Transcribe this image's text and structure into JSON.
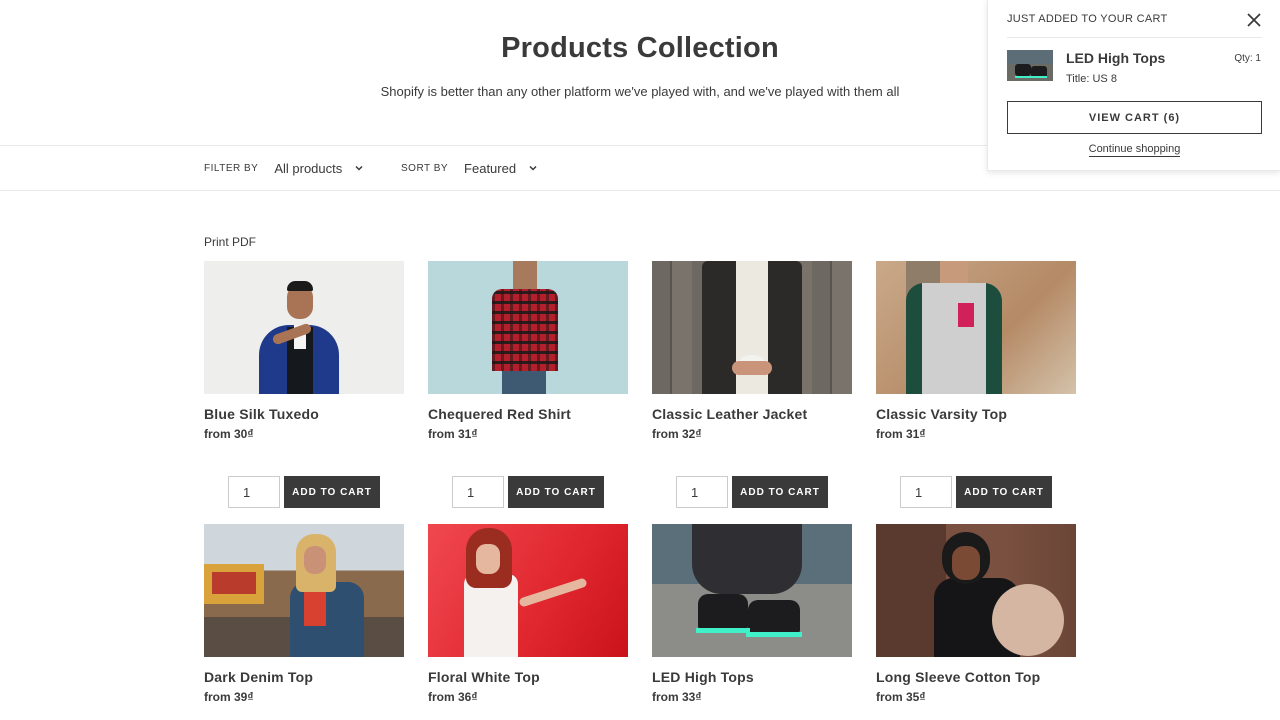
{
  "collection": {
    "title": "Products Collection",
    "description": "Shopify is better than any other platform we've played with, and we've played with them all"
  },
  "filters": {
    "filter_label": "FILTER BY",
    "filter_value": "All products",
    "sort_label": "SORT BY",
    "sort_value": "Featured"
  },
  "print_pdf": "Print PDF",
  "add_to_cart_label": "ADD TO CART",
  "products": [
    {
      "title": "Blue Silk Tuxedo",
      "price": "from 30₫",
      "qty": "1",
      "image": "tuxedo-photo"
    },
    {
      "title": "Chequered Red Shirt",
      "price": "from 31₫",
      "qty": "1",
      "image": "red-shirt-photo"
    },
    {
      "title": "Classic Leather Jacket",
      "price": "from 32₫",
      "qty": "1",
      "image": "leather-jacket-photo"
    },
    {
      "title": "Classic Varsity Top",
      "price": "from 31₫",
      "qty": "1",
      "image": "varsity-top-photo"
    },
    {
      "title": "Dark Denim Top",
      "price": "from 39₫",
      "qty": "",
      "image": "denim-top-photo"
    },
    {
      "title": "Floral White Top",
      "price": "from 36₫",
      "qty": "",
      "image": "white-top-photo"
    },
    {
      "title": "LED High Tops",
      "price": "from 33₫",
      "qty": "",
      "image": "high-tops-photo"
    },
    {
      "title": "Long Sleeve Cotton Top",
      "price": "from 35₫",
      "qty": "",
      "image": "cotton-top-photo"
    }
  ],
  "cart_popup": {
    "heading": "JUST ADDED TO YOUR CART",
    "product_name": "LED High Tops",
    "variant": "Title: US 8",
    "qty": "Qty: 1",
    "view_cart": "VIEW CART (6)",
    "continue": "Continue shopping"
  },
  "colors": {
    "text": "#3a3a3a",
    "button": "#3a3a3a",
    "border": "#e8e9eb"
  }
}
